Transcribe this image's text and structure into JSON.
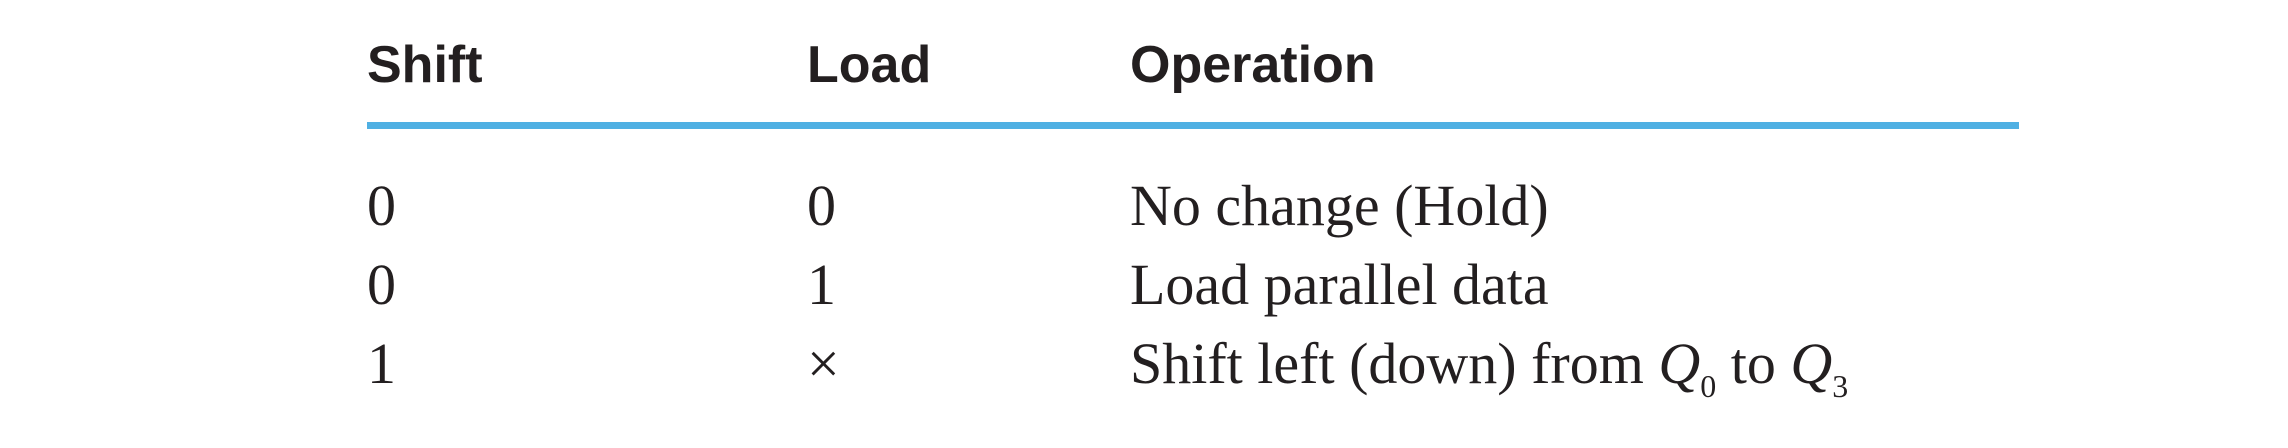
{
  "headers": {
    "shift": "Shift",
    "load": "Load",
    "operation": "Operation"
  },
  "rule_color": "#4fb0e3",
  "rows": [
    {
      "shift": "0",
      "load": "0",
      "operation": "No change (Hold)"
    },
    {
      "shift": "0",
      "load": "1",
      "operation": "Load parallel data"
    },
    {
      "shift": "1",
      "load": "×",
      "operation_parts": {
        "prefix": "Shift left (down) from ",
        "var1": "Q",
        "sub1": "0",
        "middle": " to ",
        "var2": "Q",
        "sub2": "3"
      }
    }
  ]
}
